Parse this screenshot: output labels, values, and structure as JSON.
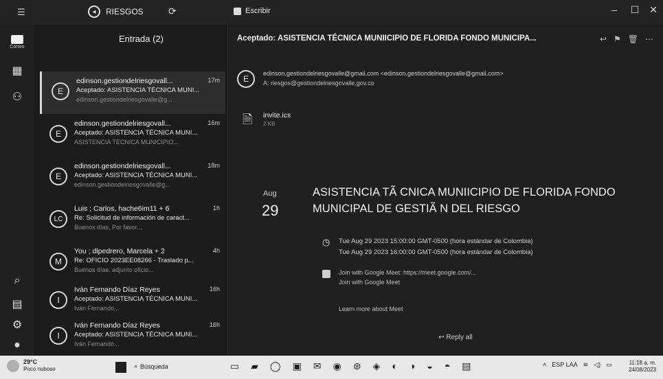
{
  "titlebar": {
    "account": "RIESGOS",
    "compose_label": "Escribir"
  },
  "rail": {
    "mail_label": "Correo"
  },
  "list": {
    "header": "Entrada (2)",
    "messages": [
      {
        "avatar": "E",
        "sender": "edinson.gestiondelriesgovall...",
        "time": "17m",
        "subject": "Aceptado: ASISTENCIA TÉCNICA MUNI...",
        "preview": "edinson.gestiondelriesgovalle@g..."
      },
      {
        "avatar": "E",
        "sender": "edinson.gestiondelriesgovall...",
        "time": "16m",
        "subject": "Aceptado: ASISTENCIA TÉCNICA MUNI...",
        "preview": "ASISTENCIA TÉCNICA MUNICIPIO..."
      },
      {
        "avatar": "E",
        "sender": "edinson.gestiondelriesgovall...",
        "time": "18m",
        "subject": "Aceptado: ASISTENCIA TÉCNICA MUNI...",
        "preview": "edinson.gestiondelriesgovalle@g..."
      },
      {
        "avatar": "LC",
        "sender": "Luis ; Carlos, hache6im11 + 6",
        "time": "1h",
        "subject": "Re: Solicitud de información de caract...",
        "preview": "Buenos días, Por favor..."
      },
      {
        "avatar": "M",
        "sender": "You ; dlpedrero, Marcela + 2",
        "time": "4h",
        "subject": "Re: OFICIO 2023EE08266 - Traslado p...",
        "preview": "Buenos días, adjunto oficio..."
      },
      {
        "avatar": "I",
        "sender": "Iván Fernando Díaz Reyes",
        "time": "16h",
        "subject": "Aceptado: ASISTENCIA TÉCNICA MUNI...",
        "preview": "Iván Fernando..."
      },
      {
        "avatar": "I",
        "sender": "Iván Fernando Díaz Reyes",
        "time": "16h",
        "subject": "Aceptado: ASISTENCIA TÉCNICA MUNI...",
        "preview": "Iván Fernando..."
      }
    ]
  },
  "pane": {
    "title": "Aceptado: ASISTENCIA TÉCNICA MUNIICIPIO DE FLORIDA FONDO MUNICIPA...",
    "from": "edinson.gestiondelriesgovalle@gmail.com <edinson.gestiondelriesgovalle@gmail.com>",
    "to": "A: riesgos@gestiondelriesgovalle.gov.co",
    "attachment_name": "invite.ics",
    "attachment_size": "2 KB",
    "event_month": "Aug",
    "event_day": "29",
    "event_title": "ASISTENCIA TÃ  CNICA MUNIICIPIO DE FLORIDA FONDO MUNICIPAL DE GESTIÃ  N DEL RIESGO",
    "when_1": "Tue Aug 29 2023 15:00:00 GMT-0500 (hora estándar de Colombia)",
    "when_2": "Tue Aug 29 2023 16:00:00 GMT-0500 (hora estándar de Colombia)",
    "meet_text": "Join with Google Meet: https://meet.google.com/...",
    "meet_link": "Join with Google Meet",
    "learn_more": "Learn more about Meet",
    "reply_all": "Reply all"
  },
  "taskbar": {
    "temp": "29°C",
    "condition": "Poco nuboso",
    "search": "Búsqueda",
    "clock_time": "11:18 a. m.",
    "clock_date": "24/08/2023",
    "lang": "ESP LAA"
  }
}
